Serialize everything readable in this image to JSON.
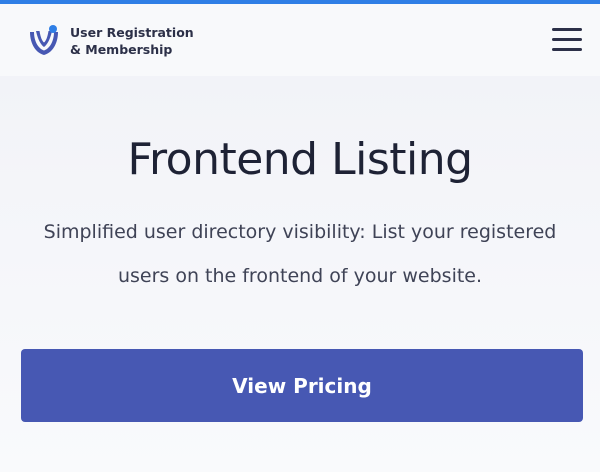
{
  "brand": {
    "line1": "User Registration",
    "line2": "& Membership",
    "logo_icon": "user-registration-logo-icon",
    "colors": {
      "primary": "#4758b3",
      "accent": "#2f7fe6"
    }
  },
  "header": {
    "menu_icon": "hamburger-menu-icon"
  },
  "hero": {
    "title": "Frontend Listing",
    "subtitle": "Simplified user directory visibility: List your registered users on the frontend of your website.",
    "cta_label": "View Pricing"
  }
}
